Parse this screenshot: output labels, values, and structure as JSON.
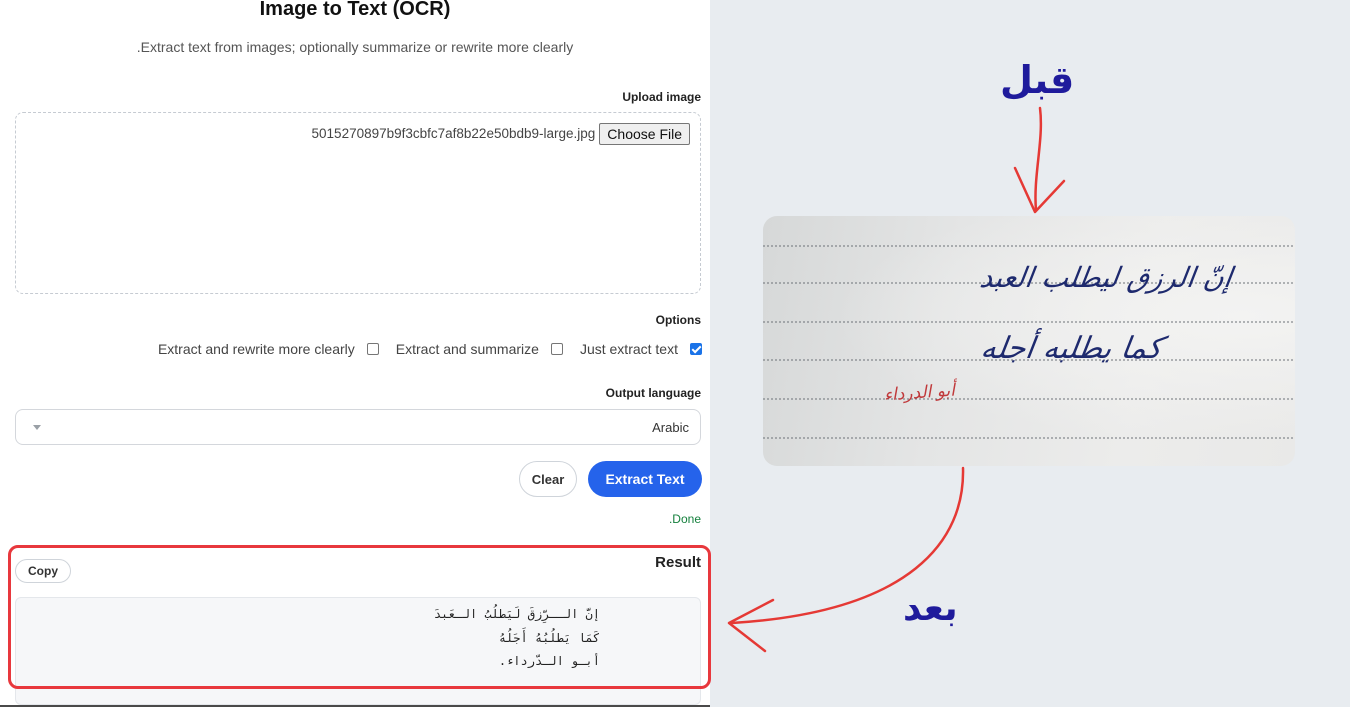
{
  "app": {
    "title": "Image to Text (OCR)",
    "subtitle": ".Extract text from images; optionally summarize or rewrite more clearly"
  },
  "upload": {
    "label": "Upload image",
    "file_name": "5015270897b9f3cbfc7af8b22e50bdb9-large.jpg",
    "button_label": "Choose File"
  },
  "options": {
    "label": "Options",
    "items": [
      {
        "label": "Just extract text",
        "checked": true
      },
      {
        "label": "Extract and summarize",
        "checked": false
      },
      {
        "label": "Extract and rewrite more clearly",
        "checked": false
      }
    ]
  },
  "language": {
    "label": "Output language",
    "selected": "Arabic",
    "caret_icon": "caret-down-icon"
  },
  "actions": {
    "clear_label": "Clear",
    "extract_label": "Extract Text"
  },
  "status": ".Done",
  "result": {
    "title": "Result",
    "copy_label": "Copy",
    "lines": [
      "إنَّ الــرِّزقَ لَيَطلُبُ الـعَبدَ",
      "كَمَا يَطلُبُهُ أَجَلُهُ",
      "أبـو الـدّرداء."
    ]
  },
  "annotation": {
    "before_label": "قبل",
    "after_label": "بعد",
    "label_color": "#1f1b9c",
    "arrow_color": "#e53935",
    "highlight_color": "#e8383d",
    "handwriting": [
      {
        "text": "إنّ الرزق ليطلب العبد",
        "color": "#1e2a6e"
      },
      {
        "text": "كما يطلبه أجله",
        "color": "#1e2a6e"
      },
      {
        "text": "أبو الدرداء",
        "color": "#c0393b"
      }
    ]
  },
  "colors": {
    "accent": "#2563eb",
    "checkbox": "#1a73e8",
    "status": "#15803d",
    "page_background": "#e8ecf0"
  }
}
